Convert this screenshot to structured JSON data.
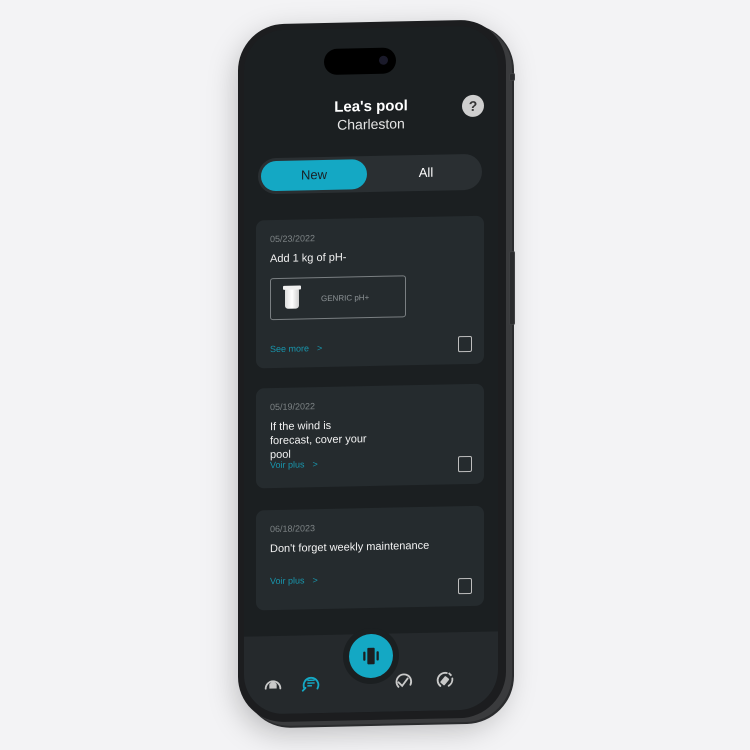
{
  "header": {
    "title": "Lea's pool",
    "subtitle": "Charleston",
    "help_icon": "?"
  },
  "tabs": [
    {
      "label": "New",
      "active": true
    },
    {
      "label": "All",
      "active": false
    }
  ],
  "cards": [
    {
      "date": "05/23/2022",
      "message": "Add 1 kg of pH-",
      "product": {
        "name": "GENRIC pH+",
        "icon": "jar-icon"
      },
      "link": "See more",
      "checked": false
    },
    {
      "date": "05/19/2022",
      "message": "If the wind is forecast, cover your pool",
      "link": "Voir plus",
      "checked": false
    },
    {
      "date": "06/18/2023",
      "message": "Don't forget weekly maintenance",
      "link": "Voir plus",
      "checked": false
    }
  ],
  "nav": {
    "items": [
      {
        "name": "home",
        "icon": "home-icon",
        "active": false
      },
      {
        "name": "tasks",
        "icon": "list-icon",
        "active": true
      },
      {
        "name": "device",
        "icon": "device-icon",
        "active": false
      },
      {
        "name": "analysis",
        "icon": "gauge-icon",
        "active": false
      },
      {
        "name": "products",
        "icon": "product-icon",
        "active": false
      }
    ]
  },
  "colors": {
    "accent": "#14a8c4",
    "background": "#1b1f21",
    "card": "#252b2e"
  },
  "link_chevron": ">"
}
